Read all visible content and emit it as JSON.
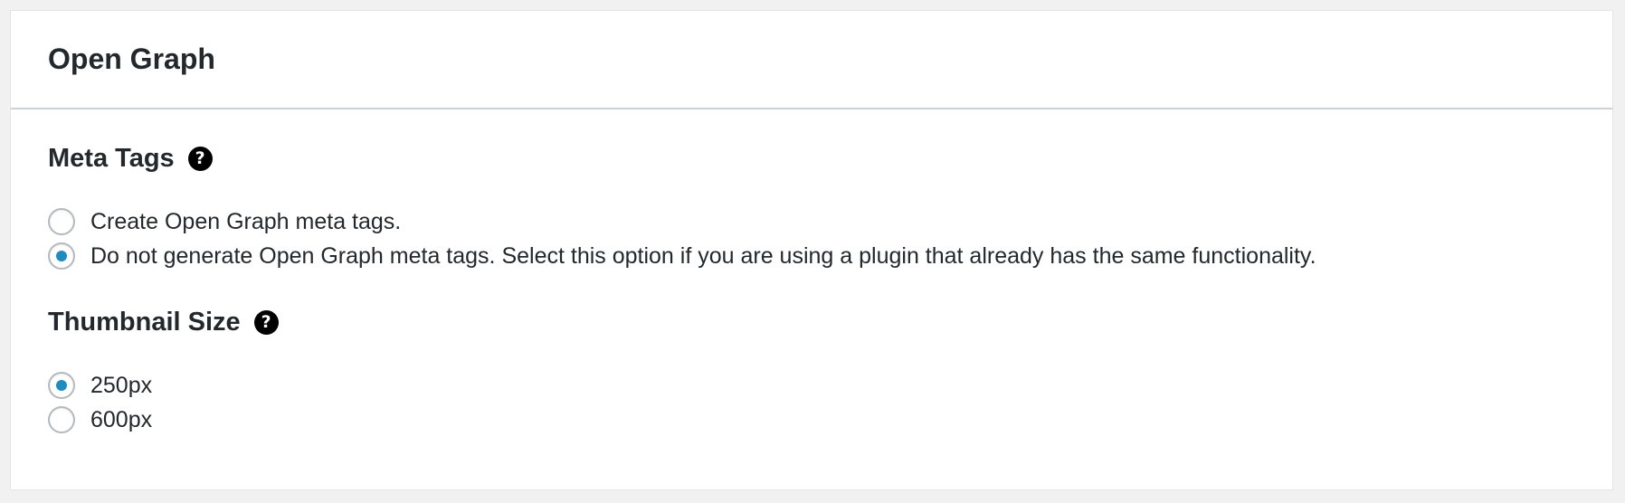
{
  "panel": {
    "title": "Open Graph"
  },
  "meta_tags": {
    "heading": "Meta Tags",
    "help_icon": "question-circle-icon",
    "options": [
      {
        "label": "Create Open Graph meta tags.",
        "checked": false
      },
      {
        "label": "Do not generate Open Graph meta tags. Select this option if you are using a plugin that already has the same functionality.",
        "checked": true
      }
    ]
  },
  "thumbnail_size": {
    "heading": "Thumbnail Size",
    "help_icon": "question-circle-icon",
    "options": [
      {
        "label": "250px",
        "checked": true
      },
      {
        "label": "600px",
        "checked": false
      }
    ]
  },
  "colors": {
    "accent": "#1e8cbe",
    "background": "#f1f1f1",
    "panel": "#ffffff",
    "text": "#23282d"
  }
}
